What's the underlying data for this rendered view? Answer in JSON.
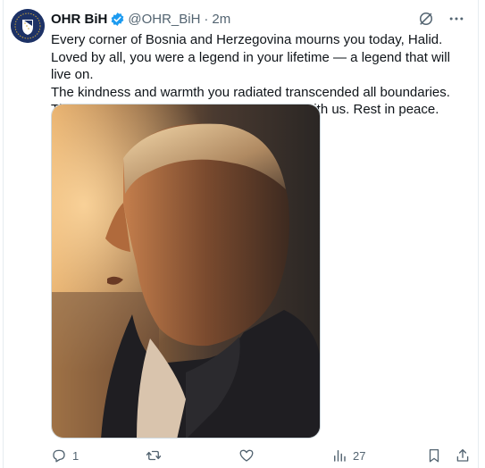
{
  "tweet": {
    "author_name": "OHR BiH",
    "handle": "@OHR_BiH",
    "separator": "·",
    "time": "2m",
    "lines": [
      "Every corner of Bosnia and Herzegovina mourns you today, Halid. Loved by all, you were a legend in your lifetime — a legend that will live on.",
      "The kindness and warmth you radiated transcended all boundaries. Thank you for all the emotions you shared with us. Rest in peace."
    ]
  },
  "actions": {
    "replies": "1",
    "views": "27"
  },
  "colors": {
    "verified": "#1d9bf0",
    "muted": "#536471",
    "text": "#0f1419"
  }
}
